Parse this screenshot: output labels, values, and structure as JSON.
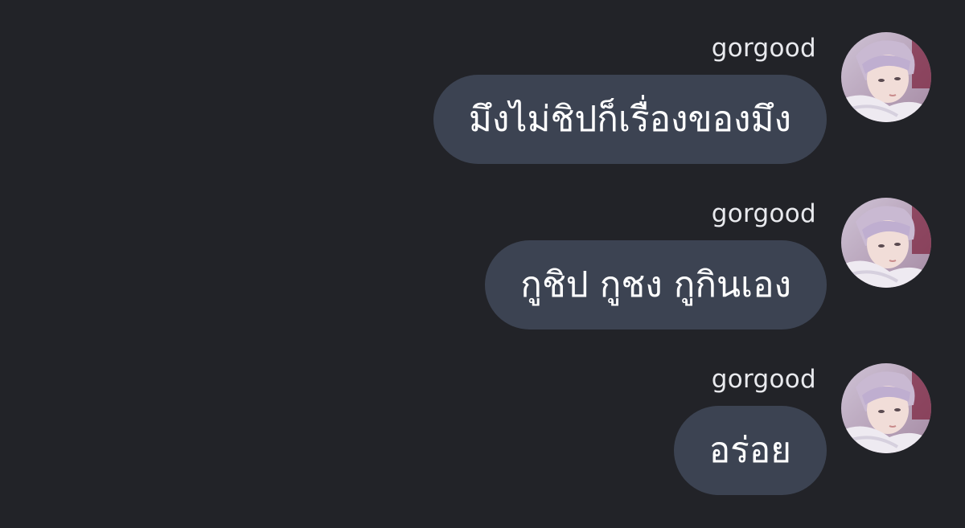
{
  "messages": [
    {
      "sender": "gorgood",
      "text": "มึงไม่ชิปก็เรื่องของมึง",
      "avatar_icon": "user-photo-avatar"
    },
    {
      "sender": "gorgood",
      "text": "กูชิป กูชง กูกินเอง",
      "avatar_icon": "user-photo-avatar"
    },
    {
      "sender": "gorgood",
      "text": "อร่อย",
      "avatar_icon": "user-photo-avatar"
    }
  ],
  "colors": {
    "background": "#222328",
    "bubble": "#3c4352",
    "text": "#ffffff",
    "sender_text": "#e9eaee"
  }
}
